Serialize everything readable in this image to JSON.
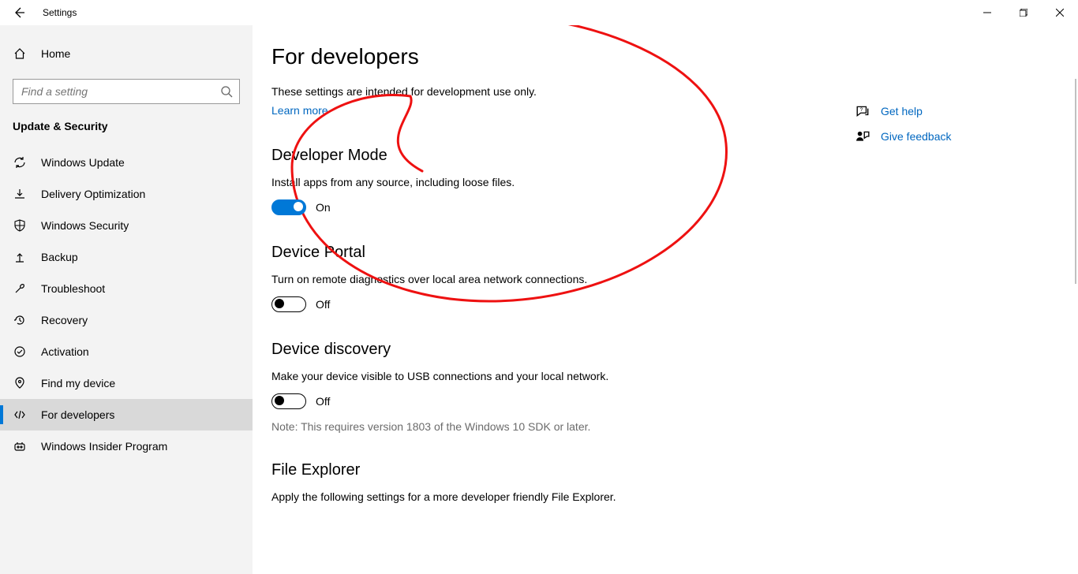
{
  "window": {
    "title": "Settings"
  },
  "sidebar": {
    "home": "Home",
    "search_placeholder": "Find a setting",
    "section": "Update & Security",
    "items": [
      {
        "label": "Windows Update"
      },
      {
        "label": "Delivery Optimization"
      },
      {
        "label": "Windows Security"
      },
      {
        "label": "Backup"
      },
      {
        "label": "Troubleshoot"
      },
      {
        "label": "Recovery"
      },
      {
        "label": "Activation"
      },
      {
        "label": "Find my device"
      },
      {
        "label": "For developers"
      },
      {
        "label": "Windows Insider Program"
      }
    ]
  },
  "main": {
    "title": "For developers",
    "subtitle": "These settings are intended for development use only.",
    "learn_more": "Learn more",
    "dev_mode": {
      "heading": "Developer Mode",
      "desc": "Install apps from any source, including loose files.",
      "state_label": "On"
    },
    "device_portal": {
      "heading": "Device Portal",
      "desc": "Turn on remote diagnostics over local area network connections.",
      "state_label": "Off"
    },
    "device_discovery": {
      "heading": "Device discovery",
      "desc": "Make your device visible to USB connections and your local network.",
      "state_label": "Off",
      "note": "Note: This requires version 1803 of the Windows 10 SDK or later."
    },
    "file_explorer": {
      "heading": "File Explorer",
      "desc": "Apply the following settings for a more developer friendly File Explorer."
    }
  },
  "right": {
    "get_help": "Get help",
    "give_feedback": "Give feedback"
  }
}
